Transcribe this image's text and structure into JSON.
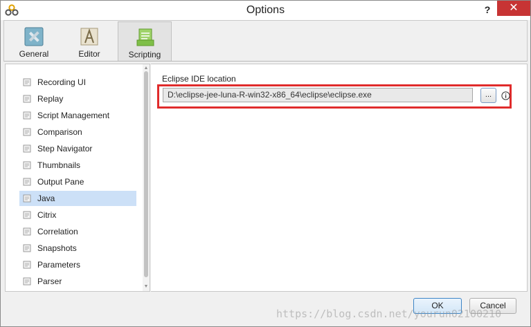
{
  "window": {
    "title": "Options",
    "help_label": "?",
    "close_label": "✕"
  },
  "toolbar": {
    "tabs": [
      {
        "label": "General",
        "icon": "general-tools-icon",
        "selected": false
      },
      {
        "label": "Editor",
        "icon": "editor-icon",
        "selected": false
      },
      {
        "label": "Scripting",
        "icon": "scripting-icon",
        "selected": true
      }
    ]
  },
  "sidebar": {
    "items": [
      {
        "label": "Recording UI"
      },
      {
        "label": "Replay"
      },
      {
        "label": "Script Management"
      },
      {
        "label": "Comparison"
      },
      {
        "label": "Step Navigator"
      },
      {
        "label": "Thumbnails"
      },
      {
        "label": "Output Pane"
      },
      {
        "label": "Java",
        "selected": true
      },
      {
        "label": "Citrix"
      },
      {
        "label": "Correlation"
      },
      {
        "label": "Snapshots"
      },
      {
        "label": "Parameters"
      },
      {
        "label": "Parser"
      }
    ],
    "scroll_up": "▲",
    "scroll_down": "▼"
  },
  "main": {
    "field_label": "Eclipse IDE location",
    "path_value": "D:\\eclipse-jee-luna-R-win32-x86_64\\eclipse\\eclipse.exe",
    "browse_label": "..."
  },
  "footer": {
    "ok_label": "OK",
    "cancel_label": "Cancel"
  },
  "watermark": "https://blog.csdn.net/yourun02100210",
  "colors": {
    "close_button": "#c73434",
    "selection": "#cce0f7",
    "highlight_border": "#e02b2b"
  }
}
